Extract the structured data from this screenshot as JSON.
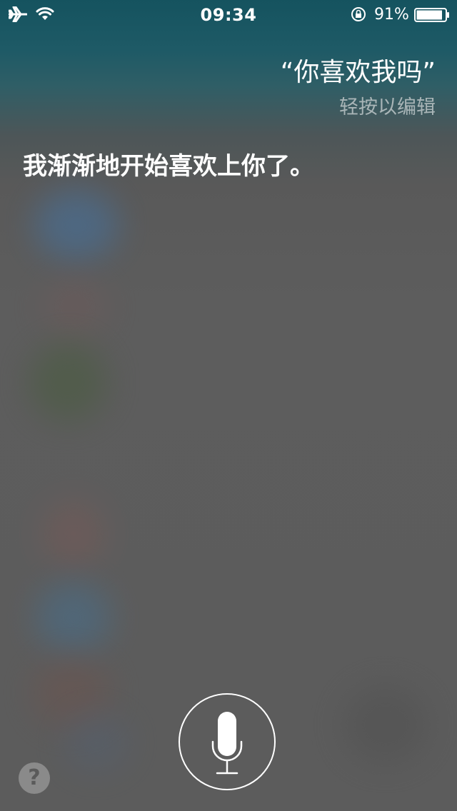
{
  "status_bar": {
    "time": "09:34",
    "battery_percent": "91%",
    "battery_level": 0.91,
    "icons": [
      "airplane-mode-icon",
      "wifi-icon",
      "rotation-lock-icon",
      "battery-icon"
    ]
  },
  "siri": {
    "query": "“你喜欢我吗”",
    "edit_hint": "轻按以编辑",
    "response": "我渐渐地开始喜欢上你了。"
  },
  "controls": {
    "mic_icon": "microphone-icon",
    "help_label": "?"
  },
  "colors": {
    "top_tint": "#15535f",
    "background": "#5c5c5c",
    "edit_hint": "#a9b5b7"
  }
}
